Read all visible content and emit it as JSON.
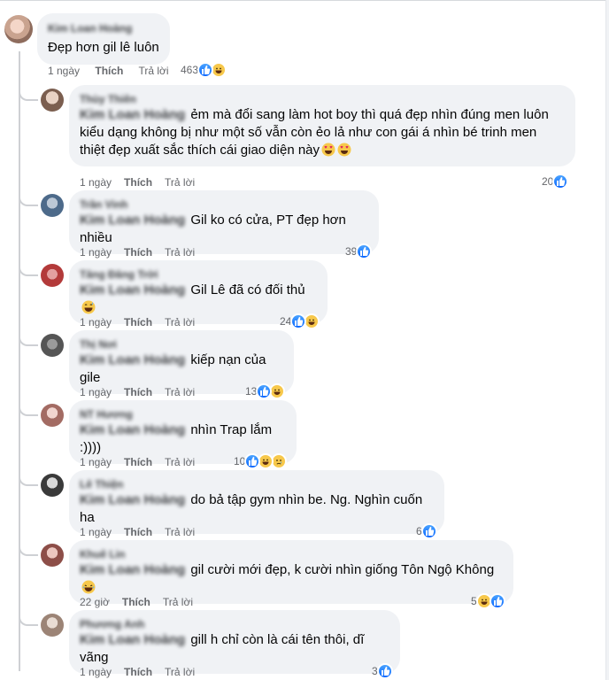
{
  "colors": {
    "bubble": "#f0f2f5",
    "meta": "#65676b",
    "like_blue": "#0866ff",
    "haha_yellow": "#f7c84b"
  },
  "main_comment": {
    "author": "Kim Loan Hoàng",
    "text": "Đẹp hơn gil lê luôn",
    "time": "1 ngày",
    "like_label": "Thích",
    "reply_label": "Trả lời",
    "reaction_count": "463",
    "reactions": [
      "like-icon",
      "haha-icon"
    ]
  },
  "replies": [
    {
      "author": "Thùy Thiên",
      "mention": "Kim Loan Hoàng",
      "lines": [
        "ẻm mà đổi sang làm hot boy thì quá đẹp nhìn đúng men luôn",
        "kiểu dạng không bị như một số vẫn còn ẻo lả như con gái á nhìn bé trinh men",
        "thiệt đẹp xuất sắc thích cái giao diện này"
      ],
      "emoji": [
        "heart-eyes-emoji",
        "heart-eyes-emoji"
      ],
      "time": "1 ngày",
      "like_label": "Thích",
      "reply_label": "Trả lời",
      "reaction_count": "20",
      "reactions": [
        "like-icon"
      ]
    },
    {
      "author": "Trần Vinh",
      "mention": "Kim Loan Hoàng",
      "lines": [
        "Gil ko có cửa, PT đẹp hơn nhiều"
      ],
      "emoji": [],
      "time": "1 ngày",
      "like_label": "Thích",
      "reply_label": "Trả lời",
      "reaction_count": "39",
      "reactions": [
        "like-icon"
      ]
    },
    {
      "author": "Tăng Đăng Trời",
      "mention": "Kim Loan Hoàng",
      "lines": [
        "Gil Lê đã có đối thủ"
      ],
      "emoji": [
        "grin-sweat-emoji"
      ],
      "time": "1 ngày",
      "like_label": "Thích",
      "reply_label": "Trả lời",
      "reaction_count": "24",
      "reactions": [
        "like-icon",
        "haha-icon"
      ]
    },
    {
      "author": "Thị Nơi",
      "mention": "Kim Loan Hoàng",
      "lines": [
        "kiếp nạn của gile"
      ],
      "emoji": [],
      "time": "1 ngày",
      "like_label": "Thích",
      "reply_label": "Trả lời",
      "reaction_count": "13",
      "reactions": [
        "like-icon",
        "haha-icon"
      ]
    },
    {
      "author": "NT Hương",
      "mention": "Kim Loan Hoàng",
      "lines": [
        "nhìn Trap lắm :))))"
      ],
      "emoji": [],
      "time": "1 ngày",
      "like_label": "Thích",
      "reply_label": "Trả lời",
      "reaction_count": "10",
      "reactions": [
        "like-icon",
        "haha-icon",
        "sad-icon"
      ]
    },
    {
      "author": "Lê Thiện",
      "mention": "Kim Loan Hoàng",
      "lines": [
        "do bả tập gym nhìn be. Ng. Nghìn cuốn ha"
      ],
      "emoji": [],
      "time": "1 ngày",
      "like_label": "Thích",
      "reply_label": "Trả lời",
      "reaction_count": "6",
      "reactions": [
        "like-icon"
      ]
    },
    {
      "author": "Khuê Lin",
      "mention": "Kim Loan Hoàng",
      "lines": [
        "gil cười mới đẹp, k cười nhìn giống Tôn Ngộ Không"
      ],
      "emoji": [
        "joy-emoji"
      ],
      "time": "22 giờ",
      "like_label": "Thích",
      "reply_label": "Trả lời",
      "reaction_count": "5",
      "reactions": [
        "haha-icon",
        "like-icon"
      ]
    },
    {
      "author": "Phương Anh",
      "mention": "Kim Loan Hoàng",
      "lines": [
        "gill h chỉ còn là cái tên thôi, dĩ vãng"
      ],
      "emoji": [],
      "time": "1 ngày",
      "like_label": "Thích",
      "reply_label": "Trả lời",
      "reaction_count": "3",
      "reactions": [
        "like-icon"
      ]
    }
  ]
}
